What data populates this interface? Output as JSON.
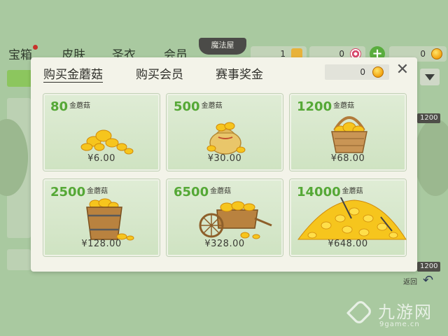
{
  "background": {
    "tabs": [
      "宝箱",
      "皮肤",
      "圣衣",
      "会员"
    ],
    "badge": "魔法屋",
    "counters": [
      "1",
      "0",
      "0"
    ],
    "prices": [
      "1200",
      "1200"
    ],
    "back_label": "返回"
  },
  "dialog": {
    "tabs": [
      {
        "label": "购买金蘑菇",
        "active": true
      },
      {
        "label": "购买会员",
        "active": false
      },
      {
        "label": "赛事奖金",
        "active": false
      }
    ],
    "balance": "0",
    "close_label": "✕",
    "products": [
      {
        "amount": "80",
        "unit": "金蘑菇",
        "price": "¥6.00",
        "art": "small-pile"
      },
      {
        "amount": "500",
        "unit": "金蘑菇",
        "price": "¥30.00",
        "art": "sack"
      },
      {
        "amount": "1200",
        "unit": "金蘑菇",
        "price": "¥68.00",
        "art": "basket"
      },
      {
        "amount": "2500",
        "unit": "金蘑菇",
        "price": "¥128.00",
        "art": "bucket"
      },
      {
        "amount": "6500",
        "unit": "金蘑菇",
        "price": "¥328.00",
        "art": "cart"
      },
      {
        "amount": "14000",
        "unit": "金蘑菇",
        "price": "¥648.00",
        "art": "big-pile"
      }
    ]
  },
  "watermark": {
    "title": "九游网",
    "url": "9game.cn"
  },
  "colors": {
    "accent_green": "#55a836",
    "coin_gold": "#f2a20e",
    "dialog_bg": "#f3f3e9"
  }
}
